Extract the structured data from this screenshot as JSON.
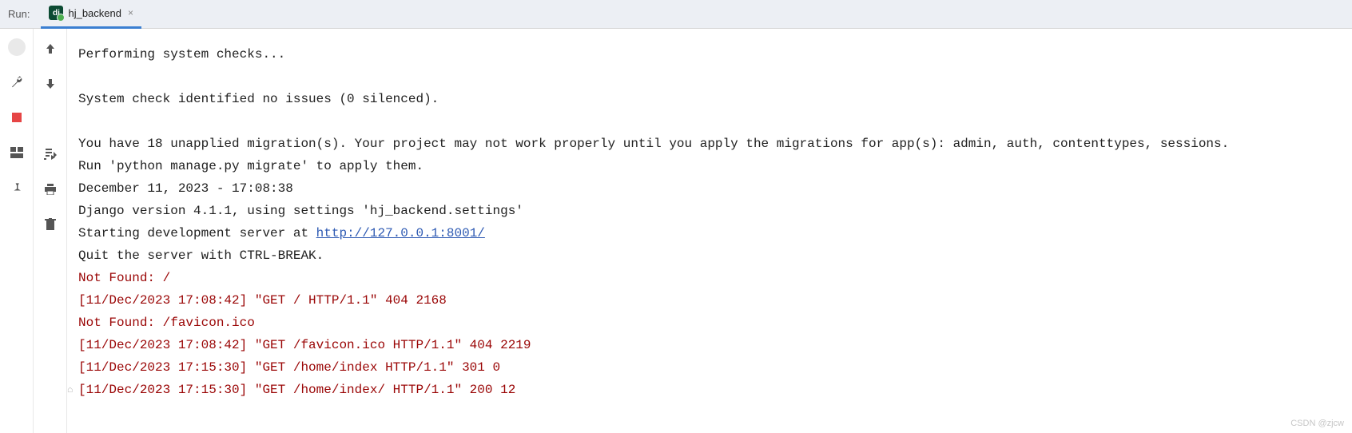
{
  "header": {
    "run_label": "Run:",
    "tab": {
      "icon_text": "dj",
      "label": "hj_backend",
      "close": "×"
    }
  },
  "console": {
    "lines": [
      {
        "text": "Performing system checks...",
        "cls": ""
      },
      {
        "text": "",
        "cls": ""
      },
      {
        "text": "System check identified no issues (0 silenced).",
        "cls": ""
      },
      {
        "text": "",
        "cls": ""
      },
      {
        "text": "You have 18 unapplied migration(s). Your project may not work properly until you apply the migrations for app(s): admin, auth, contenttypes, sessions.",
        "cls": ""
      },
      {
        "text": "Run 'python manage.py migrate' to apply them.",
        "cls": ""
      },
      {
        "text": "December 11, 2023 - 17:08:38",
        "cls": ""
      },
      {
        "text": "Django version 4.1.1, using settings 'hj_backend.settings'",
        "cls": ""
      }
    ],
    "server_line_prefix": "Starting development server at ",
    "server_url": "http://127.0.0.1:8001/",
    "post_lines": [
      {
        "text": "Quit the server with CTRL-BREAK.",
        "cls": ""
      },
      {
        "text": "Not Found: /",
        "cls": "err"
      },
      {
        "text": "[11/Dec/2023 17:08:42] \"GET / HTTP/1.1\" 404 2168",
        "cls": "err"
      },
      {
        "text": "Not Found: /favicon.ico",
        "cls": "err"
      },
      {
        "text": "[11/Dec/2023 17:08:42] \"GET /favicon.ico HTTP/1.1\" 404 2219",
        "cls": "err"
      },
      {
        "text": "[11/Dec/2023 17:15:30] \"GET /home/index HTTP/1.1\" 301 0",
        "cls": "err"
      },
      {
        "text": "[11/Dec/2023 17:15:30] \"GET /home/index/ HTTP/1.1\" 200 12",
        "cls": "err"
      }
    ]
  },
  "watermark": "CSDN @zjcw"
}
